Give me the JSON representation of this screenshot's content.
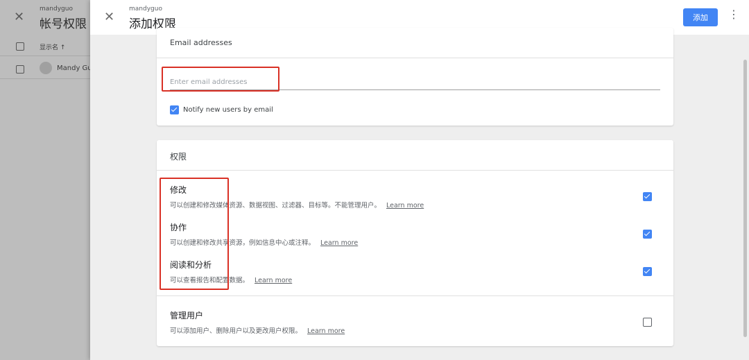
{
  "background": {
    "close_icon": "✕",
    "account_name": "mandyguo",
    "title": "帐号权限",
    "column_label": "显示名 ↑",
    "user_name": "Mandy Gu"
  },
  "drawer": {
    "close_icon": "✕",
    "account_name": "mandyguo",
    "title": "添加权限",
    "add_label": "添加",
    "more_icon": "⋮"
  },
  "email_card": {
    "header": "Email addresses",
    "input_placeholder": "Enter email addresses",
    "input_value": "",
    "notify_label": "Notify new users by email",
    "notify_checked": true
  },
  "permissions_card": {
    "header": "权限",
    "items": [
      {
        "title": "修改",
        "desc": "可以创建和修改媒体资源、数据视图、过滤器、目标等。不能管理用户。",
        "link": "Learn more",
        "checked": true
      },
      {
        "title": "协作",
        "desc": "可以创建和修改共享资源，例如信息中心或注释。",
        "link": "Learn more",
        "checked": true
      },
      {
        "title": "阅读和分析",
        "desc": "可以查看报告和配置数据。",
        "link": "Learn more",
        "checked": true
      },
      {
        "title": "管理用户",
        "desc": "可以添加用户、删除用户以及更改用户权限。",
        "link": "Learn more",
        "checked": false
      }
    ]
  },
  "colors": {
    "accent": "#4285f4",
    "highlight": "#d93025"
  }
}
